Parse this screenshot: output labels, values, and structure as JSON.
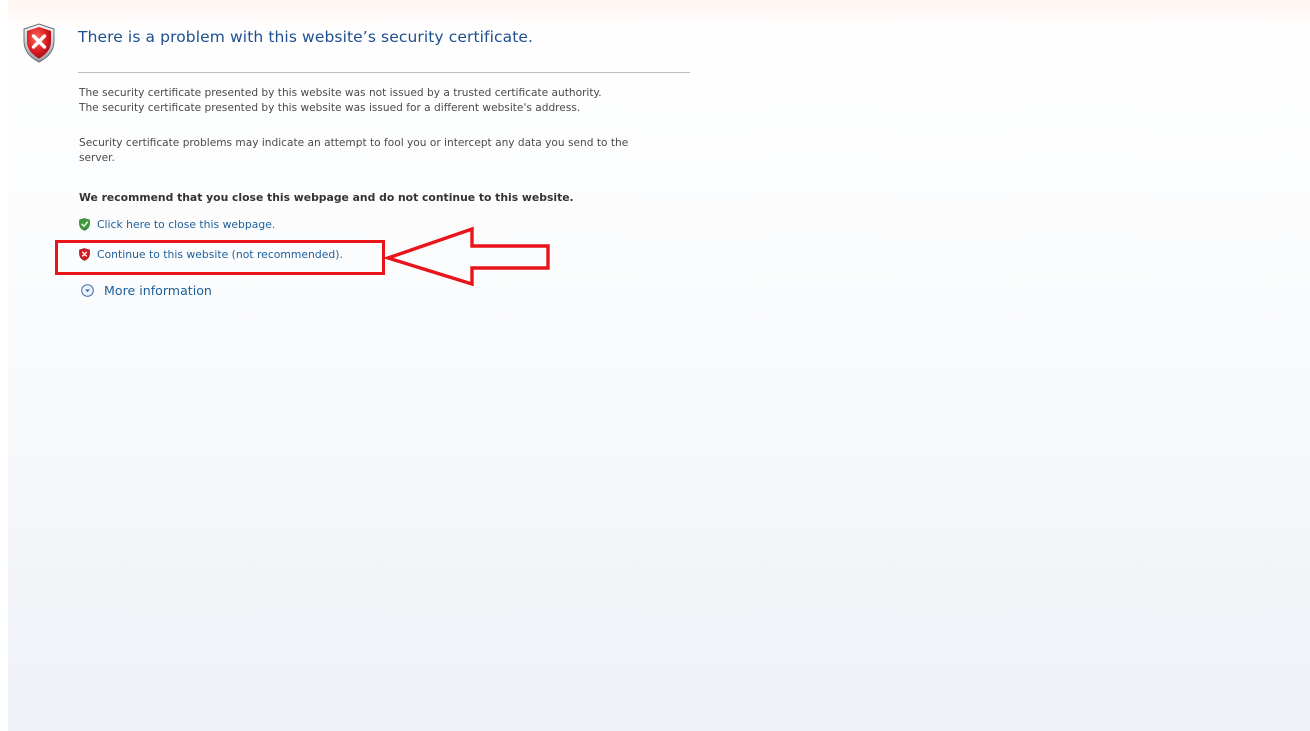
{
  "page": {
    "heading": "There is a problem with this website’s security certificate.",
    "paragraph1_line1": "The security certificate presented by this website was not issued by a trusted certificate authority.",
    "paragraph1_line2": "The security certificate presented by this website was issued for a different website's address.",
    "paragraph2_line1": "Security certificate problems may indicate an attempt to fool you or intercept any data you send to the",
    "paragraph2_line2": "server.",
    "recommendation": "We recommend that you close this webpage and do not continue to this website.",
    "close_link": "Click here to close this webpage.",
    "continue_link": "Continue to this website (not recommended).",
    "more_info": "More information"
  },
  "icons": {
    "header": "shield-error-icon",
    "close": "shield-check-icon",
    "continue": "shield-error-icon",
    "more_info": "chevron-down-circle-icon"
  },
  "colors": {
    "heading": "#1f4e8f",
    "link": "#1e5f9a",
    "annotation": "#e8141a",
    "shield_red": "#c8141b",
    "shield_green": "#2f8f2f"
  }
}
